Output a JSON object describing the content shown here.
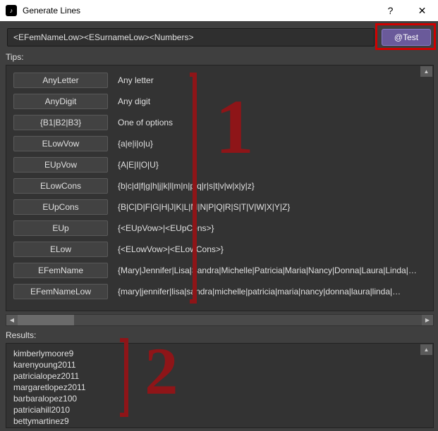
{
  "window": {
    "title": "Generate Lines",
    "help_symbol": "?",
    "close_symbol": "✕",
    "icon_glyph": "♪"
  },
  "pattern_value": "<EFemNameLow><ESurnameLow><Numbers>",
  "test_label": "@Test",
  "tips_label": "Tips:",
  "tips": [
    {
      "btn": "AnyLetter",
      "desc": "Any letter"
    },
    {
      "btn": "AnyDigit",
      "desc": "Any digit"
    },
    {
      "btn": "{B1|B2|B3}",
      "desc": "One of options"
    },
    {
      "btn": "ELowVow",
      "desc": "{a|e|i|o|u}"
    },
    {
      "btn": "EUpVow",
      "desc": "{A|E|I|O|U}"
    },
    {
      "btn": "ELowCons",
      "desc": "{b|c|d|f|g|h|j|k|l|m|n|p|q|r|s|t|v|w|x|y|z}"
    },
    {
      "btn": "EUpCons",
      "desc": "{B|C|D|F|G|H|J|K|L|M|N|P|Q|R|S|T|V|W|X|Y|Z}"
    },
    {
      "btn": "EUp",
      "desc": "{<EUpVow>|<EUpCons>}"
    },
    {
      "btn": "ELow",
      "desc": "{<ELowVow>|<ELowCons>}"
    },
    {
      "btn": "EFemName",
      "desc": "{Mary|Jennifer|Lisa|Sandra|Michelle|Patricia|Maria|Nancy|Donna|Laura|Linda|…"
    },
    {
      "btn": "EFemNameLow",
      "desc": "{mary|jennifer|lisa|sandra|michelle|patricia|maria|nancy|donna|laura|linda|…"
    }
  ],
  "results_label": "Results:",
  "results": [
    "kimberlymoore9",
    "karenyoung2011",
    "patricialopez2011",
    "margaretlopez2011",
    "barbaralopez100",
    "patriciahill2010",
    "bettymartinez9"
  ],
  "annotations": {
    "num1": "1",
    "num2": "2"
  }
}
